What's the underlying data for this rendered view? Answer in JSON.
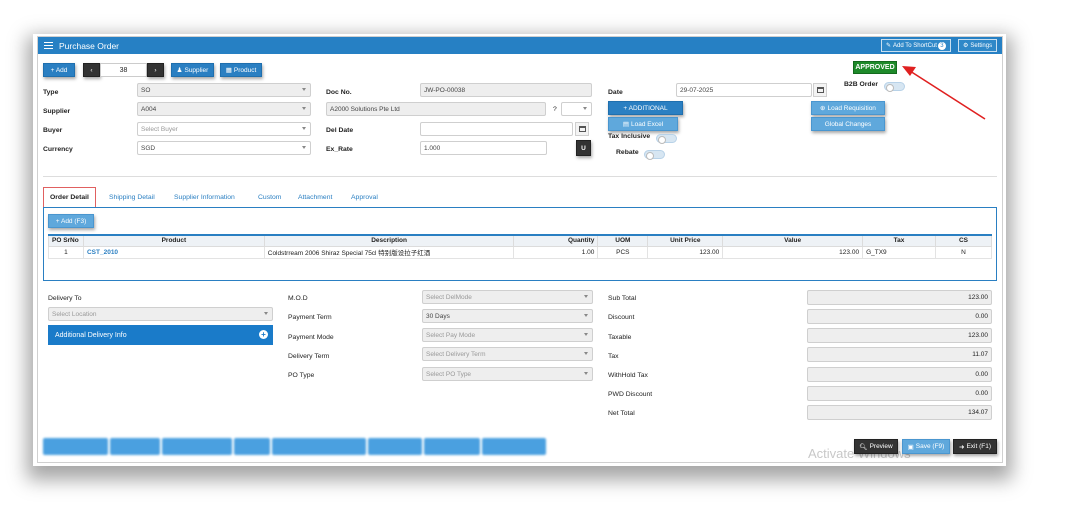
{
  "window": {
    "title": "Purchase Order",
    "add_to_shortcut": "Add To ShortCut",
    "shortcut_count": "3",
    "settings": "Settings"
  },
  "toolbar": {
    "add": "+ Add",
    "record_no": "38",
    "supplier": "Supplier",
    "product": "Product"
  },
  "status": "APPROVED",
  "form": {
    "type_label": "Type",
    "type_value": "SO",
    "supplier_label": "Supplier",
    "supplier_code": "A004",
    "supplier_name": "A2000 Solutions Pte Ltd",
    "supplier_q": "?",
    "buyer_label": "Buyer",
    "buyer_placeholder": "Select Buyer",
    "currency_label": "Currency",
    "currency_value": "SGD",
    "docno_label": "Doc No.",
    "docno_value": "JW-PO-00038",
    "deldate_label": "Del Date",
    "deldate_value": "",
    "exrate_label": "Ex_Rate",
    "exrate_value": "1.000",
    "exrate_btn": "U",
    "date_label": "Date",
    "date_value": "29-07-2025",
    "additional_btn": "+ ADDITIONAL",
    "load_excel_btn": "Load Excel",
    "tax_inclusive_label": "Tax Inclusive",
    "rebate_label": "Rebate",
    "b2b_label": "B2B Order",
    "load_requisition_btn": "Load Requisition",
    "global_changes_btn": "Global Changes"
  },
  "tabs": [
    "Order Detail",
    "Shipping Detail",
    "Supplier Information",
    "Custom",
    "Attachment",
    "Approval"
  ],
  "grid": {
    "add_btn": "+ Add (F3)",
    "columns": [
      "PO SrNo",
      "Product",
      "Description",
      "Quantity",
      "UOM",
      "Unit Price",
      "Value",
      "Tax",
      "CS"
    ],
    "rows": [
      [
        "1",
        "CST_2010",
        "Coldstrream 2006 Shiraz Special 75cl 特别版设拉子红酒",
        "1.00",
        "PCS",
        "123.00",
        "123.00",
        "G_TX9",
        "N"
      ]
    ]
  },
  "delivery": {
    "to_label": "Delivery To",
    "location_placeholder": "Select Location",
    "additional_info": "Additional Delivery Info"
  },
  "terms": {
    "mod_label": "M.O.D",
    "mod_placeholder": "Select DelMode",
    "payment_term_label": "Payment Term",
    "payment_term_value": "30 Days",
    "payment_mode_label": "Payment Mode",
    "payment_mode_placeholder": "Select Pay Mode",
    "delivery_term_label": "Delivery Term",
    "delivery_term_placeholder": "Select Delivery Term",
    "po_type_label": "PO Type",
    "po_type_placeholder": "Select PO Type"
  },
  "summary": [
    {
      "label": "Sub Total",
      "value": "123.00"
    },
    {
      "label": "Discount",
      "value": "0.00"
    },
    {
      "label": "Taxable",
      "value": "123.00"
    },
    {
      "label": "Tax",
      "value": "11.07"
    },
    {
      "label": "WithHold Tax",
      "value": "0.00"
    },
    {
      "label": "PWD Discount",
      "value": "0.00"
    },
    {
      "label": "Net Total",
      "value": "134.07"
    }
  ],
  "footer": {
    "preview": "Preview",
    "save": "Save (F9)",
    "exit": "Exit (F1)",
    "watermark": "Activate Windows"
  },
  "colors": {
    "accent": "#2a7fc2",
    "approved": "#1e8a2a",
    "arrow": "#e02020"
  }
}
